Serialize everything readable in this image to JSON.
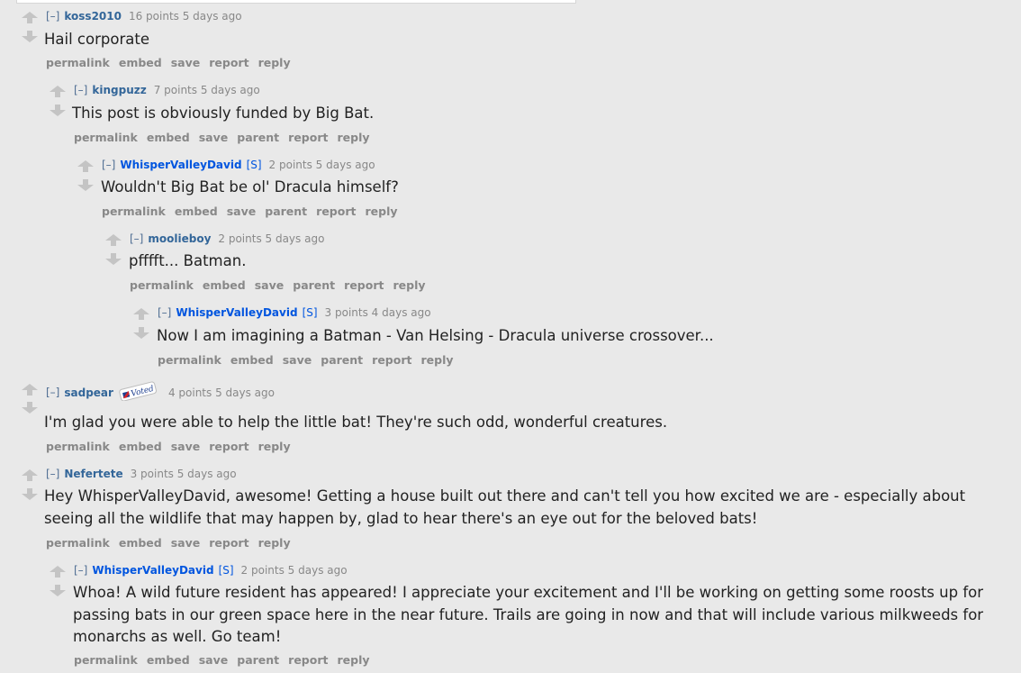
{
  "colors": {
    "background": "#e9e9e9",
    "author": "#336699",
    "op_author": "#0055df",
    "meta": "#888888",
    "text": "#222222",
    "arrow": "#c4c4c4"
  },
  "icons": {
    "upvote": "up-arrow-icon",
    "downvote": "down-arrow-icon",
    "flair": "voted-sticker-icon"
  },
  "flair_text": "Voted",
  "comments": [
    {
      "toggle": "[–]",
      "author": "koss2010",
      "submitter": "",
      "meta": "16 points 5 days ago",
      "body": "Hail corporate",
      "actions": [
        "permalink",
        "embed",
        "save",
        "report",
        "reply"
      ]
    },
    {
      "toggle": "[–]",
      "author": "kingpuzz",
      "submitter": "",
      "meta": "7 points 5 days ago",
      "body": "This post is obviously funded by Big Bat.",
      "actions": [
        "permalink",
        "embed",
        "save",
        "parent",
        "report",
        "reply"
      ]
    },
    {
      "toggle": "[–]",
      "author": "WhisperValleyDavid",
      "submitter": "[S]",
      "meta": "2 points 5 days ago",
      "body": "Wouldn't Big Bat be ol' Dracula himself?",
      "actions": [
        "permalink",
        "embed",
        "save",
        "parent",
        "report",
        "reply"
      ]
    },
    {
      "toggle": "[–]",
      "author": "moolieboy",
      "submitter": "",
      "meta": "2 points 5 days ago",
      "body": "pfffft... Batman.",
      "actions": [
        "permalink",
        "embed",
        "save",
        "parent",
        "report",
        "reply"
      ]
    },
    {
      "toggle": "[–]",
      "author": "WhisperValleyDavid",
      "submitter": "[S]",
      "meta": "3 points 4 days ago",
      "body": "Now I am imagining a Batman - Van Helsing - Dracula universe crossover...",
      "actions": [
        "permalink",
        "embed",
        "save",
        "parent",
        "report",
        "reply"
      ]
    },
    {
      "toggle": "[–]",
      "author": "sadpear",
      "submitter": "",
      "meta": "4 points 5 days ago",
      "body": "I'm glad you were able to help the little bat! They're such odd, wonderful creatures.",
      "actions": [
        "permalink",
        "embed",
        "save",
        "report",
        "reply"
      ]
    },
    {
      "toggle": "[–]",
      "author": "Nefertete",
      "submitter": "",
      "meta": "3 points 5 days ago",
      "body": "Hey WhisperValleyDavid, awesome! Getting a house built out there and can't tell you how excited we are - especially about seeing all the wildlife that may happen by, glad to hear there's an eye out for the beloved bats!",
      "actions": [
        "permalink",
        "embed",
        "save",
        "report",
        "reply"
      ]
    },
    {
      "toggle": "[–]",
      "author": "WhisperValleyDavid",
      "submitter": "[S]",
      "meta": "2 points 5 days ago",
      "body": "Whoa! A wild future resident has appeared! I appreciate your excitement and I'll be working on getting some roosts up for passing bats in our green space here in the near future. Trails are going in now and that will include various milkweeds for monarchs as well. Go team!",
      "actions": [
        "permalink",
        "embed",
        "save",
        "parent",
        "report",
        "reply"
      ]
    }
  ]
}
